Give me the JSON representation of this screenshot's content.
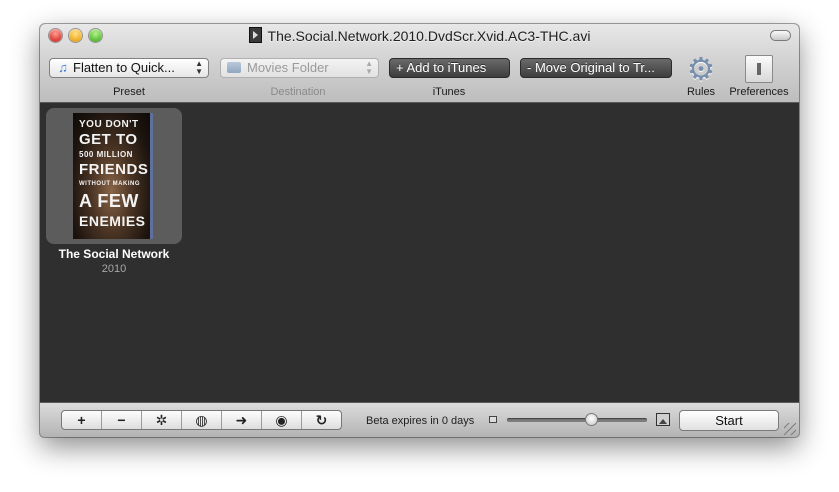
{
  "window": {
    "title": "The.Social.Network.2010.DvdScr.Xvid.AC3-THC.avi"
  },
  "toolbar": {
    "preset_value": "Flatten to Quick...",
    "destination_value": "Movies Folder",
    "add_itunes_label": "+ Add to iTunes",
    "move_original_label": "- Move Original to Tr...",
    "labels": {
      "preset": "Preset",
      "destination": "Destination",
      "itunes": "iTunes",
      "rules": "Rules",
      "preferences": "Preferences"
    }
  },
  "items": [
    {
      "title": "The Social Network",
      "year": "2010",
      "poster_lines": [
        "YOU DON'T",
        "GET TO",
        "500 MILLION",
        "FRIENDS",
        "WITHOUT MAKING",
        "A FEW",
        "ENEMIES"
      ]
    }
  ],
  "bottom": {
    "buttons": [
      "+",
      "−",
      "✲",
      "◍",
      "➜",
      "◉",
      "↻"
    ],
    "beta_text": "Beta expires in 0 days",
    "slider_fraction": 0.6,
    "start_label": "Start"
  }
}
